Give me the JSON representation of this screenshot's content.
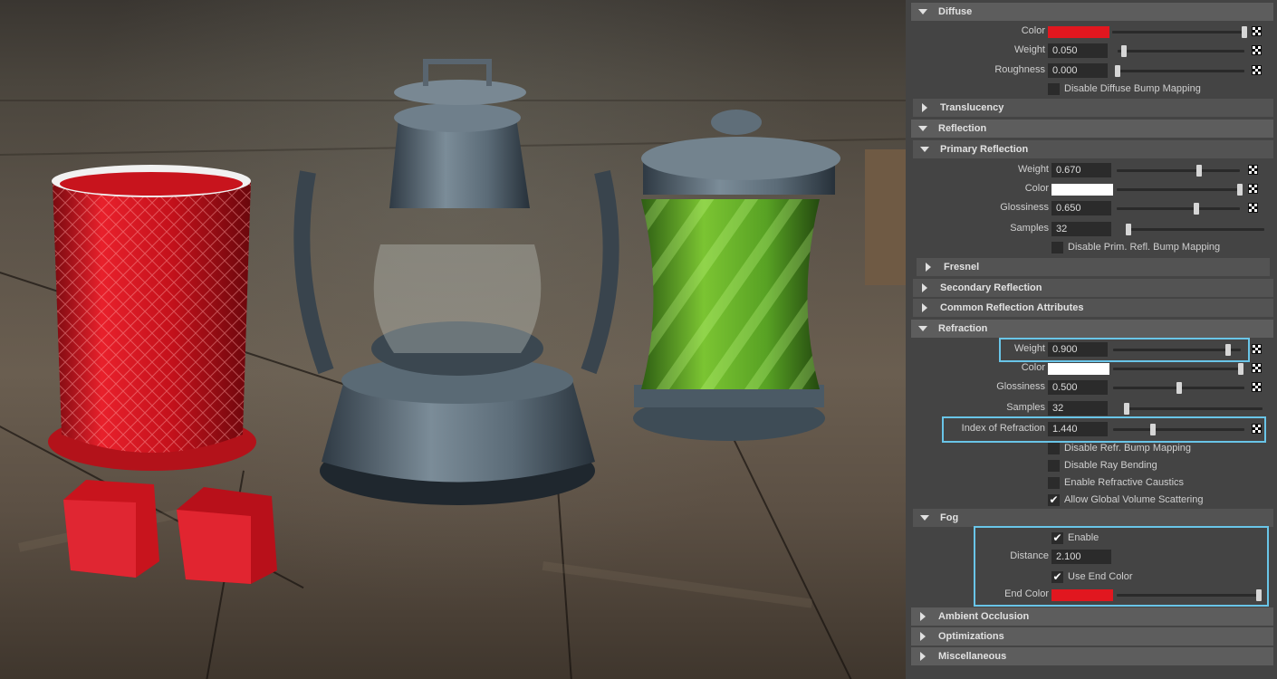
{
  "panel": {
    "diffuse": {
      "title": "Diffuse",
      "color_label": "Color",
      "color_value": "#e1171f",
      "weight_label": "Weight",
      "weight_value": "0.050",
      "roughness_label": "Roughness",
      "roughness_value": "0.000",
      "disable_bump_label": "Disable Diffuse Bump Mapping"
    },
    "translucency": {
      "title": "Translucency"
    },
    "reflection": {
      "title": "Reflection"
    },
    "primary_reflection": {
      "title": "Primary Reflection",
      "weight_label": "Weight",
      "weight_value": "0.670",
      "color_label": "Color",
      "color_value": "#ffffff",
      "glossiness_label": "Glossiness",
      "glossiness_value": "0.650",
      "samples_label": "Samples",
      "samples_value": "32",
      "disable_bump_label": "Disable Prim. Refl. Bump Mapping"
    },
    "fresnel": {
      "title": "Fresnel"
    },
    "secondary_reflection": {
      "title": "Secondary Reflection"
    },
    "common_reflection": {
      "title": "Common Reflection Attributes"
    },
    "refraction": {
      "title": "Refraction",
      "weight_label": "Weight",
      "weight_value": "0.900",
      "color_label": "Color",
      "color_value": "#ffffff",
      "glossiness_label": "Glossiness",
      "glossiness_value": "0.500",
      "samples_label": "Samples",
      "samples_value": "32",
      "ior_label": "Index of Refraction",
      "ior_value": "1.440",
      "disable_bump_label": "Disable Refr. Bump Mapping",
      "disable_ray_bending_label": "Disable Ray Bending",
      "enable_caustics_label": "Enable Refractive Caustics",
      "allow_volume_scattering_label": "Allow Global Volume Scattering"
    },
    "fog": {
      "title": "Fog",
      "enable_label": "Enable",
      "distance_label": "Distance",
      "distance_value": "2.100",
      "use_end_color_label": "Use End Color",
      "end_color_label": "End Color",
      "end_color_value": "#e1171f"
    },
    "ambient_occlusion": {
      "title": "Ambient Occlusion"
    },
    "optimizations": {
      "title": "Optimizations"
    },
    "miscellaneous": {
      "title": "Miscellaneous"
    }
  },
  "sliders": {
    "diffuse_color": 1.0,
    "diffuse_weight": 0.05,
    "diffuse_roughness": 0.0,
    "prim_weight": 0.67,
    "prim_color": 1.0,
    "prim_glossiness": 0.65,
    "prim_samples": 0.0,
    "refr_weight": 0.9,
    "refr_color": 1.0,
    "refr_glossiness": 0.5,
    "refr_samples": 0.0,
    "refr_ior": 0.3,
    "fog_end_color": 1.0
  },
  "checkboxes": {
    "diffuse_disable_bump": false,
    "prim_disable_bump": false,
    "refr_disable_bump": false,
    "refr_disable_ray_bending": false,
    "refr_enable_caustics": false,
    "refr_allow_volume_scattering": true,
    "fog_enable": true,
    "fog_use_end_color": true
  },
  "colors": {
    "highlight": "#69c5e8",
    "panel_bg": "#444444",
    "section_header": "#5d5d5d",
    "field_bg": "#2b2b2b"
  },
  "icons": {
    "expanded": "triangle-down",
    "collapsed": "triangle-right",
    "map_button": "checker-map-icon",
    "checked": "✔"
  }
}
